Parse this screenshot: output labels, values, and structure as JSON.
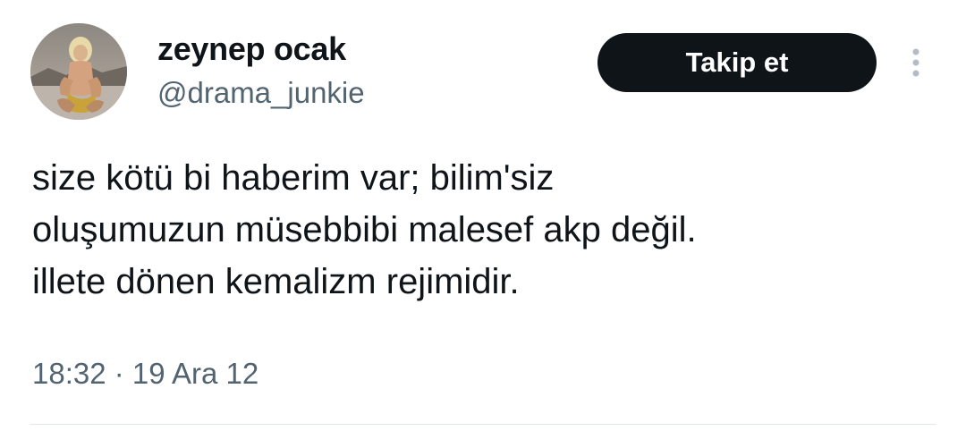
{
  "user": {
    "display_name": "zeynep ocak",
    "handle": "@drama_junkie"
  },
  "follow_button": {
    "label": "Takip et"
  },
  "more_menu": {
    "icon": "more-vertical-icon"
  },
  "tweet": {
    "lines": [
      "size kötü bi haberim var; bilim'siz",
      "oluşumuzun müsebbibi malesef akp değil.",
      "illete dönen kemalizm rejimidir."
    ],
    "timestamp": "18:32 · 19 Ara 12"
  },
  "colors": {
    "text": "#0f1419",
    "secondary_text": "#536471",
    "button_background": "#0f1419",
    "button_text": "#ffffff",
    "divider": "#e1e6ea"
  }
}
